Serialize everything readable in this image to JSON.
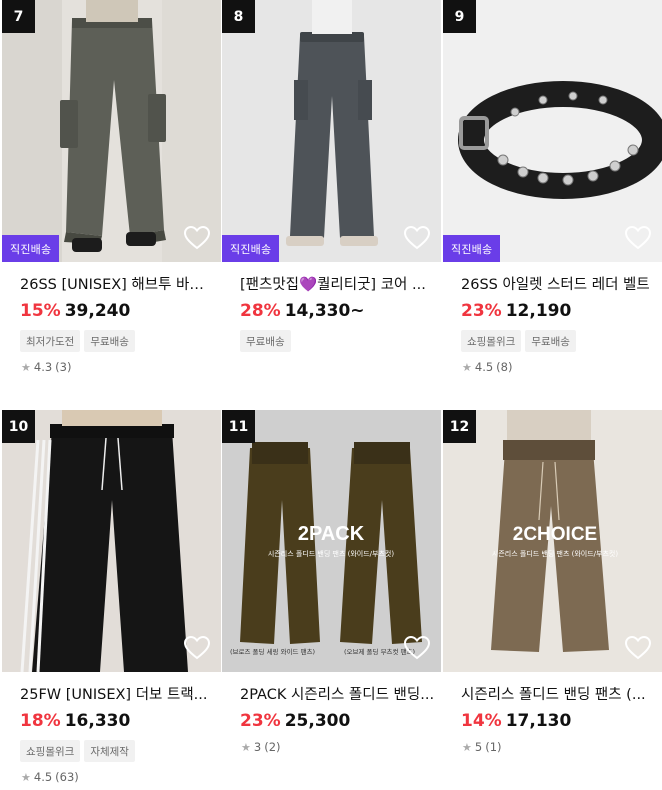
{
  "products": [
    {
      "rank": "7",
      "badge": "직진배송",
      "title": "26SS [UNISEX] 해브투 바이...",
      "discount": "15%",
      "price": "39,240",
      "tags": [
        "최저가도전",
        "무료배송"
      ],
      "rating": "4.3",
      "reviews": "(3)"
    },
    {
      "rank": "8",
      "badge": "직진배송",
      "title": "[팬츠맛집💜퀄리티굿] 코어 ...",
      "discount": "28%",
      "price": "14,330~",
      "tags": [
        "무료배송"
      ],
      "rating": "",
      "reviews": ""
    },
    {
      "rank": "9",
      "badge": "직진배송",
      "title": "26SS 아일렛 스터드 레더 벨트",
      "discount": "23%",
      "price": "12,190",
      "tags": [
        "쇼핑몰위크",
        "무료배송"
      ],
      "rating": "4.5",
      "reviews": "(8)"
    },
    {
      "rank": "10",
      "badge": "",
      "title": "25FW [UNISEX] 더보 트랙...",
      "discount": "18%",
      "price": "16,330",
      "tags": [
        "쇼핑몰위크",
        "자체제작"
      ],
      "rating": "4.5",
      "reviews": "(63)"
    },
    {
      "rank": "11",
      "badge": "",
      "title": "2PACK 시즌리스 폴디드 밴딩...",
      "discount": "23%",
      "price": "25,300",
      "tags": [],
      "rating": "3",
      "reviews": "(2)"
    },
    {
      "rank": "12",
      "badge": "",
      "title": "시즌리스 폴디드 밴딩 팬츠 (...",
      "discount": "14%",
      "price": "17,130",
      "tags": [],
      "rating": "5",
      "reviews": "(1)"
    }
  ],
  "image_text": {
    "p11_big": "2PACK",
    "p11_sub": "시즌리스 폴디드 밴딩 팬츠 (와이드/부츠컷)",
    "p11_left": "(브로즈 폴딩 세링 와이드 팬츠)",
    "p11_right": "(오브제 폴딩 부츠컷 팬츠)",
    "p12_big": "2CHOICE",
    "p12_sub": "시즌리스 폴디드 밴딩 팬츠 (와이드/부츠컷)"
  },
  "colors": {
    "discount": "#f0353f",
    "badge": "#6a3de8",
    "rank_bg": "#111111"
  },
  "icons": {
    "wishlist": "heart-outline-icon",
    "rating": "star-icon"
  }
}
